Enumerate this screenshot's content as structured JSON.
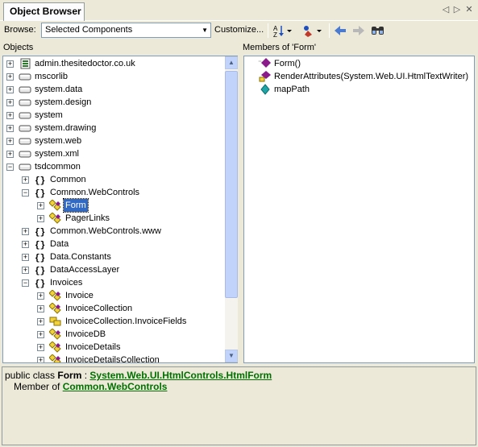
{
  "tab": {
    "title": "Object Browser"
  },
  "toolbar": {
    "browse_label": "Browse:",
    "browse_value": "Selected Components",
    "customize_label": "Customize..."
  },
  "objects_header": "Objects",
  "members_header": "Members of 'Form'",
  "tree": [
    {
      "label": "admin.thesitedoctor.co.uk",
      "kind": "project",
      "level": 0,
      "state": "plus"
    },
    {
      "label": "mscorlib",
      "kind": "assembly",
      "level": 0,
      "state": "plus"
    },
    {
      "label": "system.data",
      "kind": "assembly",
      "level": 0,
      "state": "plus"
    },
    {
      "label": "system.design",
      "kind": "assembly",
      "level": 0,
      "state": "plus"
    },
    {
      "label": "system",
      "kind": "assembly",
      "level": 0,
      "state": "plus"
    },
    {
      "label": "system.drawing",
      "kind": "assembly",
      "level": 0,
      "state": "plus"
    },
    {
      "label": "system.web",
      "kind": "assembly",
      "level": 0,
      "state": "plus"
    },
    {
      "label": "system.xml",
      "kind": "assembly",
      "level": 0,
      "state": "plus"
    },
    {
      "label": "tsdcommon",
      "kind": "assembly",
      "level": 0,
      "state": "minus"
    },
    {
      "label": "Common",
      "kind": "namespace",
      "level": 1,
      "state": "plus"
    },
    {
      "label": "Common.WebControls",
      "kind": "namespace",
      "level": 1,
      "state": "minus"
    },
    {
      "label": "Form",
      "kind": "class",
      "level": 2,
      "state": "plus",
      "selected": true
    },
    {
      "label": "PagerLinks",
      "kind": "class",
      "level": 2,
      "state": "plus"
    },
    {
      "label": "Common.WebControls.www",
      "kind": "namespace",
      "level": 1,
      "state": "plus"
    },
    {
      "label": "Data",
      "kind": "namespace",
      "level": 1,
      "state": "plus"
    },
    {
      "label": "Data.Constants",
      "kind": "namespace",
      "level": 1,
      "state": "plus"
    },
    {
      "label": "DataAccessLayer",
      "kind": "namespace",
      "level": 1,
      "state": "plus"
    },
    {
      "label": "Invoices",
      "kind": "namespace",
      "level": 1,
      "state": "minus"
    },
    {
      "label": "Invoice",
      "kind": "class",
      "level": 2,
      "state": "plus"
    },
    {
      "label": "InvoiceCollection",
      "kind": "class",
      "level": 2,
      "state": "plus"
    },
    {
      "label": "InvoiceCollection.InvoiceFields",
      "kind": "enum",
      "level": 2,
      "state": "plus"
    },
    {
      "label": "InvoiceDB",
      "kind": "class",
      "level": 2,
      "state": "plus"
    },
    {
      "label": "InvoiceDetails",
      "kind": "class",
      "level": 2,
      "state": "plus"
    },
    {
      "label": "InvoiceDetailsCollection",
      "kind": "class",
      "level": 2,
      "state": "plus"
    }
  ],
  "members": [
    {
      "label": "Form()",
      "kind": "method"
    },
    {
      "label": "RenderAttributes(System.Web.UI.HtmlTextWriter)",
      "kind": "protected-method"
    },
    {
      "label": "mapPath",
      "kind": "field"
    }
  ],
  "description": {
    "prefix": "public class ",
    "name": "Form",
    "sep": " : ",
    "base": "System.Web.UI.HtmlControls.HtmlForm",
    "member_of_label": "Member of ",
    "member_of": "Common.WebControls"
  },
  "colors": {
    "selection": "#316ac5",
    "link": "#007000",
    "method_icon": "#8b1a8b",
    "field_icon": "#1fa5a5"
  }
}
